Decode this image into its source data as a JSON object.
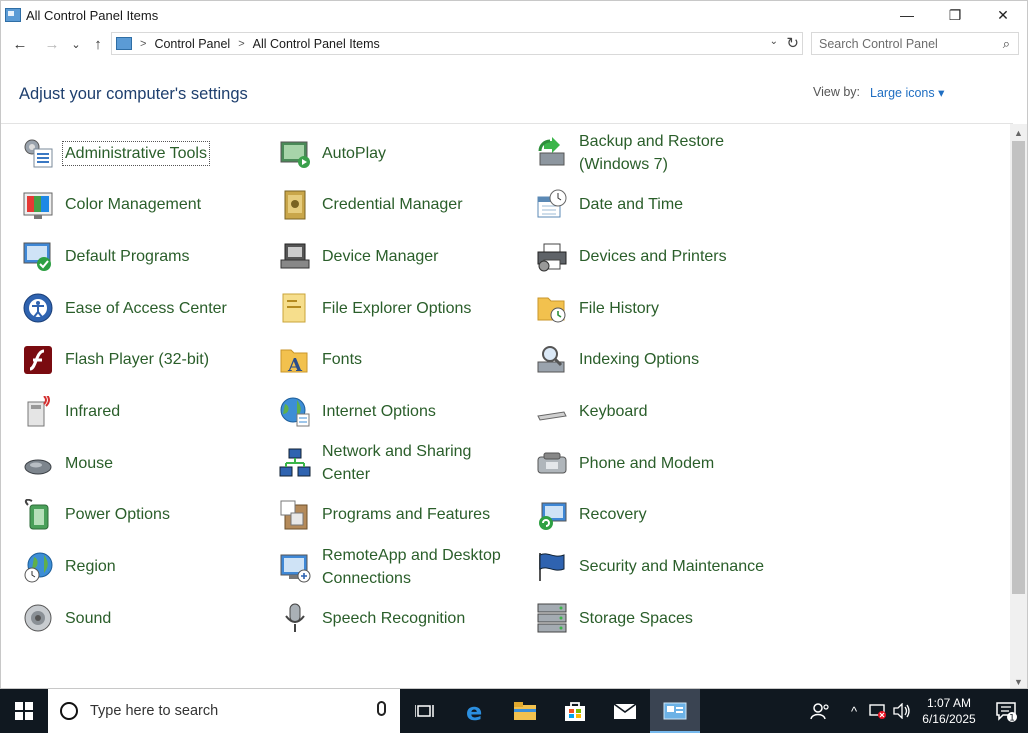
{
  "window": {
    "title": "All Control Panel Items",
    "minimize": "—",
    "restore": "❐",
    "close": "✕"
  },
  "nav": {
    "back": "←",
    "forward": "→",
    "recent": "⌄",
    "up": "↑",
    "breadcrumbs": [
      "Control Panel",
      "All Control Panel Items"
    ],
    "search_placeholder": "Search Control Panel"
  },
  "header": {
    "heading": "Adjust your computer's settings",
    "view_by_label": "View by:",
    "view_by_value": "Large icons ▾"
  },
  "items": [
    {
      "label": "Administrative Tools",
      "icon": "admin-tools-icon"
    },
    {
      "label": "AutoPlay",
      "icon": "autoplay-icon"
    },
    {
      "label": "Backup and Restore\n(Windows 7)",
      "icon": "backup-icon"
    },
    {
      "label": "Color Management",
      "icon": "color-management-icon"
    },
    {
      "label": "Credential Manager",
      "icon": "credential-icon"
    },
    {
      "label": "Date and Time",
      "icon": "datetime-icon"
    },
    {
      "label": "Default Programs",
      "icon": "default-programs-icon"
    },
    {
      "label": "Device Manager",
      "icon": "device-manager-icon"
    },
    {
      "label": "Devices and Printers",
      "icon": "printer-icon"
    },
    {
      "label": "Ease of Access Center",
      "icon": "ease-access-icon"
    },
    {
      "label": "File Explorer Options",
      "icon": "folder-options-icon"
    },
    {
      "label": "File History",
      "icon": "file-history-icon"
    },
    {
      "label": "Flash Player (32-bit)",
      "icon": "flash-icon"
    },
    {
      "label": "Fonts",
      "icon": "fonts-icon"
    },
    {
      "label": "Indexing Options",
      "icon": "indexing-icon"
    },
    {
      "label": "Infrared",
      "icon": "infrared-icon"
    },
    {
      "label": "Internet Options",
      "icon": "globe-icon"
    },
    {
      "label": "Keyboard",
      "icon": "keyboard-icon"
    },
    {
      "label": "Mouse",
      "icon": "mouse-icon"
    },
    {
      "label": "Network and Sharing\nCenter",
      "icon": "network-icon"
    },
    {
      "label": "Phone and Modem",
      "icon": "phone-icon"
    },
    {
      "label": "Power Options",
      "icon": "power-icon"
    },
    {
      "label": "Programs and Features",
      "icon": "programs-icon"
    },
    {
      "label": "Recovery",
      "icon": "recovery-icon"
    },
    {
      "label": "Region",
      "icon": "region-icon"
    },
    {
      "label": "RemoteApp and Desktop\nConnections",
      "icon": "remoteapp-icon"
    },
    {
      "label": "Security and Maintenance",
      "icon": "security-flag-icon"
    },
    {
      "label": "Sound",
      "icon": "speaker-icon"
    },
    {
      "label": "Speech Recognition",
      "icon": "microphone-icon"
    },
    {
      "label": "Storage Spaces",
      "icon": "storage-icon"
    }
  ],
  "taskbar": {
    "search_text": "Type here to search",
    "time": "1:07 AM",
    "date": "6/16/2025",
    "notification_count": "1"
  },
  "colors": {
    "link_green": "#2a5e2a",
    "heading_blue": "#1e3f6e",
    "accent_blue": "#1f6ec2",
    "taskbar": "#101820"
  }
}
